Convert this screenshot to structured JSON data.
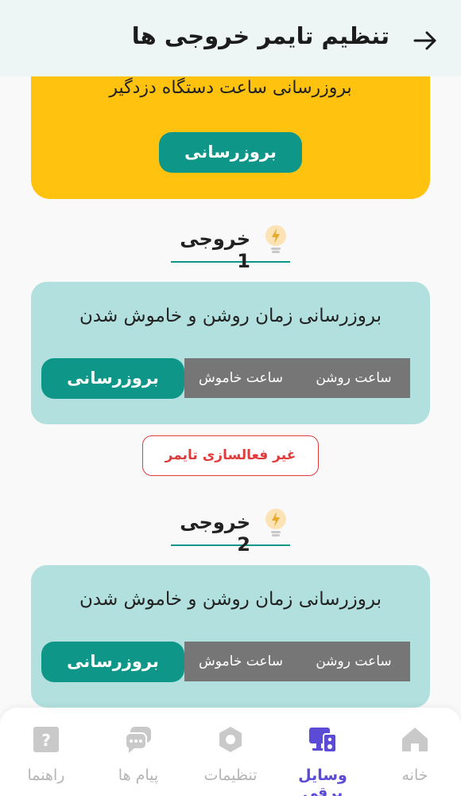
{
  "header": {
    "title": "تنظیم تایمر خروجی ها",
    "back_icon": "arrow-right-icon"
  },
  "alarm_card": {
    "text": "بروزرسانی ساعت دستگاه دزدگیر",
    "button_label": "بروزرسانی",
    "color": "#ffc20f"
  },
  "outputs": [
    {
      "title": "خروجی 1",
      "icon": "lightbulb-icon",
      "card_text": "بروزرسانی زمان روشن و خاموش شدن",
      "on_label": "ساعت روشن",
      "off_label": "ساعت خاموش",
      "button_label": "بروزرسانی",
      "disable_label": "غیر فعالسازی تایمر"
    },
    {
      "title": "خروجی 2",
      "icon": "lightbulb-icon",
      "card_text": "بروزرسانی زمان روشن و خاموش شدن",
      "on_label": "ساعت روشن",
      "off_label": "ساعت خاموش",
      "button_label": "بروزرسانی"
    }
  ],
  "nav": {
    "items": [
      {
        "label": "خانه",
        "icon": "home-icon",
        "active": false
      },
      {
        "label": "وسایل برقی",
        "icon": "devices-icon",
        "active": true
      },
      {
        "label": "تنظیمات",
        "icon": "settings-icon",
        "active": false
      },
      {
        "label": "پیام ها",
        "icon": "messages-icon",
        "active": false
      },
      {
        "label": "راهنما",
        "icon": "help-icon",
        "active": false
      }
    ]
  },
  "colors": {
    "accent": "#0e9688",
    "card": "#b2e0de",
    "active_nav": "#5b4bd6",
    "danger": "#e03c3c"
  }
}
